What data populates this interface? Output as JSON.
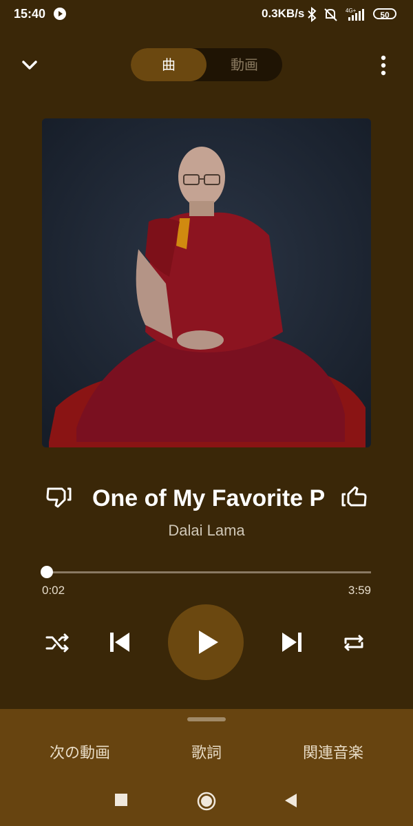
{
  "status_bar": {
    "time": "15:40",
    "network_speed": "0.3KB/s",
    "signal_label": "4G+",
    "battery": "50"
  },
  "tabs": {
    "song": "曲",
    "video": "動画",
    "active": "song"
  },
  "album_art": {
    "description_icon": "album-artwork"
  },
  "track": {
    "title": "One of My Favorite P",
    "artist": "Dalai Lama"
  },
  "playback": {
    "elapsed": "0:02",
    "total": "3:59",
    "progress_fraction": 0.008
  },
  "bottom_tabs": {
    "next": "次の動画",
    "lyrics": "歌詞",
    "related": "関連音楽"
  },
  "colors": {
    "background": "#3a2708",
    "accent": "#6b4810",
    "bottom_panel": "#674410"
  }
}
